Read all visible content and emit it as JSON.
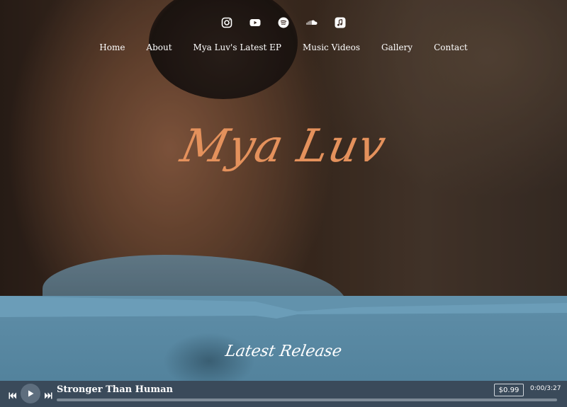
{
  "socials": [
    {
      "icon": "instagram-icon"
    },
    {
      "icon": "youtube-icon"
    },
    {
      "icon": "spotify-icon"
    },
    {
      "icon": "soundcloud-icon"
    },
    {
      "icon": "apple-music-icon"
    }
  ],
  "nav": {
    "items": [
      "Home",
      "About",
      "Mya Luv's Latest EP",
      "Music Videos",
      "Gallery",
      "Contact"
    ]
  },
  "hero": {
    "title": "Mya Luv",
    "title_color": "#e4915c"
  },
  "release": {
    "heading": "Latest Release",
    "bg_color": "#5f8ea8"
  },
  "player": {
    "track_title": "Stronger Than Human",
    "price": "$0.99",
    "time": "0:00/3:27",
    "progress": 0.0,
    "prev_icon": "skip-back-icon",
    "play_icon": "play-icon",
    "next_icon": "skip-forward-icon"
  }
}
